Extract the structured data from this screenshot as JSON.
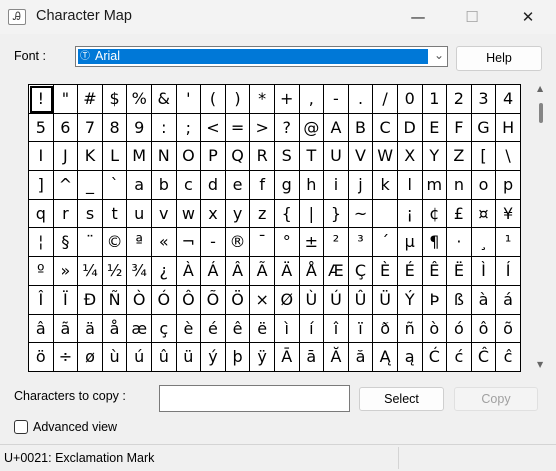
{
  "window": {
    "title": "Character Map",
    "icon": "char-map-app-icon",
    "icon_glyph": "Ꭿ",
    "controls": {
      "minimize": "—",
      "maximize": "☐",
      "close": "✕"
    }
  },
  "font_selector": {
    "label": "Font :",
    "value": "Arial",
    "icon_glyph": "Ⓣ",
    "dropdown_glyph": "⌄"
  },
  "buttons": {
    "help": "Help",
    "select": "Select",
    "copy": "Copy"
  },
  "grid": {
    "rows": [
      [
        "!",
        "\"",
        "#",
        "$",
        "%",
        "&",
        "'",
        "(",
        ")",
        "*",
        "+",
        ",",
        "-",
        ".",
        "/",
        "0",
        "1",
        "2",
        "3",
        "4"
      ],
      [
        "5",
        "6",
        "7",
        "8",
        "9",
        ":",
        ";",
        "<",
        "=",
        ">",
        "?",
        "@",
        "A",
        "B",
        "C",
        "D",
        "E",
        "F",
        "G",
        "H"
      ],
      [
        "I",
        "J",
        "K",
        "L",
        "M",
        "N",
        "O",
        "P",
        "Q",
        "R",
        "S",
        "T",
        "U",
        "V",
        "W",
        "X",
        "Y",
        "Z",
        "[",
        "\\"
      ],
      [
        "]",
        "^",
        "_",
        "`",
        "a",
        "b",
        "c",
        "d",
        "e",
        "f",
        "g",
        "h",
        "i",
        "j",
        "k",
        "l",
        "m",
        "n",
        "o",
        "p"
      ],
      [
        "q",
        "r",
        "s",
        "t",
        "u",
        "v",
        "w",
        "x",
        "y",
        "z",
        "{",
        "|",
        "}",
        "~",
        " ",
        "¡",
        "¢",
        "£",
        "¤",
        "¥"
      ],
      [
        "¦",
        "§",
        "¨",
        "©",
        "ª",
        "«",
        "¬",
        "-",
        "®",
        "¯",
        "°",
        "±",
        "²",
        "³",
        "´",
        "µ",
        "¶",
        "·",
        "¸",
        "¹"
      ],
      [
        "º",
        "»",
        "¼",
        "½",
        "¾",
        "¿",
        "À",
        "Á",
        "Â",
        "Ã",
        "Ä",
        "Å",
        "Æ",
        "Ç",
        "È",
        "É",
        "Ê",
        "Ë",
        "Ì",
        "Í"
      ],
      [
        "Î",
        "Ï",
        "Ð",
        "Ñ",
        "Ò",
        "Ó",
        "Ô",
        "Õ",
        "Ö",
        "×",
        "Ø",
        "Ù",
        "Ú",
        "Û",
        "Ü",
        "Ý",
        "Þ",
        "ß",
        "à",
        "á"
      ],
      [
        "â",
        "ã",
        "ä",
        "å",
        "æ",
        "ç",
        "è",
        "é",
        "ê",
        "ë",
        "ì",
        "í",
        "î",
        "ï",
        "ð",
        "ñ",
        "ò",
        "ó",
        "ô",
        "õ"
      ],
      [
        "ö",
        "÷",
        "ø",
        "ù",
        "ú",
        "û",
        "ü",
        "ý",
        "þ",
        "ÿ",
        "Ā",
        "ā",
        "Ă",
        "ă",
        "Ą",
        "ą",
        "Ć",
        "ć",
        "Ĉ",
        "ĉ"
      ]
    ],
    "selected": "!"
  },
  "scrollbar": {
    "up_glyph": "▲",
    "down_glyph": "▼"
  },
  "copy_field": {
    "label": "Characters to copy :",
    "value": ""
  },
  "advanced_view": {
    "label": "Advanced view",
    "checked": false
  },
  "status": {
    "text": "U+0021: Exclamation Mark"
  },
  "colors": {
    "accent": "#0078d7",
    "background": "#f0f0f0",
    "grid_lines": "#000000"
  }
}
